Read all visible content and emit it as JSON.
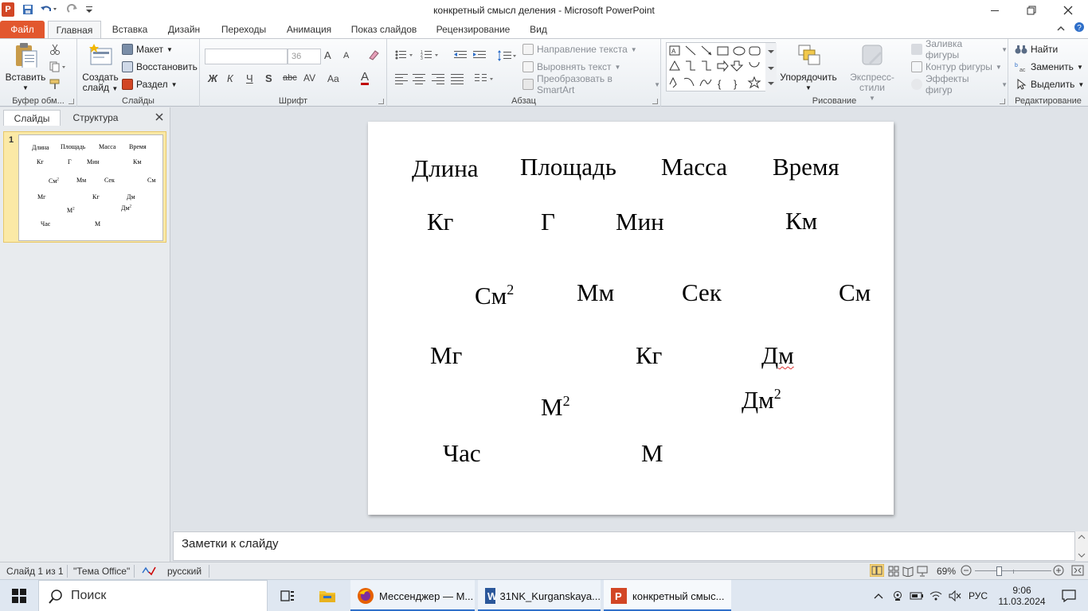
{
  "window": {
    "title": "конкретный смысл деления  -  Microsoft PowerPoint",
    "app_logo": "P"
  },
  "tabs": {
    "file": "Файл",
    "items": [
      "Главная",
      "Вставка",
      "Дизайн",
      "Переходы",
      "Анимация",
      "Показ слайдов",
      "Рецензирование",
      "Вид"
    ]
  },
  "ribbon": {
    "clipboard": {
      "paste": "Вставить",
      "label": "Буфер обм..."
    },
    "slides": {
      "new_slide_line1": "Создать",
      "new_slide_line2": "слайд",
      "layout": "Макет",
      "reset": "Восстановить",
      "section": "Раздел",
      "label": "Слайды"
    },
    "font": {
      "font_name": "",
      "font_size": "36",
      "label": "Шрифт",
      "bold": "Ж",
      "italic": "К",
      "underline": "Ч",
      "shadow": "S",
      "strike": "abc",
      "spacing": "AV",
      "case": "Aa",
      "color": "A",
      "grow": "A",
      "shrink": "A"
    },
    "paragraph": {
      "text_direction": "Направление текста",
      "align_text": "Выровнять текст",
      "smartart": "Преобразовать в SmartArt",
      "label": "Абзац"
    },
    "drawing": {
      "arrange": "Упорядочить",
      "quick_styles": "Экспресс-стили",
      "shape_fill": "Заливка фигуры",
      "shape_outline": "Контур фигуры",
      "shape_effects": "Эффекты фигур",
      "label": "Рисование"
    },
    "editing": {
      "find": "Найти",
      "replace": "Заменить",
      "select": "Выделить",
      "label": "Редактирование"
    }
  },
  "left_panel": {
    "tab_slides": "Слайды",
    "tab_outline": "Структура",
    "slide_number": "1"
  },
  "slide": {
    "row1": [
      "Длина",
      "Площадь",
      "Масса",
      "Время"
    ],
    "kg1": "Кг",
    "g": "Г",
    "min": "Мин",
    "km": "Км",
    "cm2": "См",
    "mm": "Мм",
    "sek": "Сек",
    "sm": "См",
    "mg": "Мг",
    "kg2": "Кг",
    "dm": "Дм",
    "m2": "М",
    "dm2": "Дм",
    "chas": "Час",
    "m": "М",
    "sup2": "2"
  },
  "notes": {
    "placeholder": "Заметки к слайду"
  },
  "status": {
    "slide_info": "Слайд 1 из 1",
    "theme": "\"Тема Office\"",
    "language": "русский",
    "zoom": "69%",
    "zoom_fraction": 0.69
  },
  "taskbar": {
    "search": "Поиск",
    "apps": [
      {
        "label": "Мессенджер — М..."
      },
      {
        "label": "31NK_Kurganskaya..."
      },
      {
        "label": "конкретный смыс..."
      }
    ],
    "lang": "РУС",
    "time": "9:06",
    "date": "11.03.2024"
  },
  "colors": {
    "file_tab": "#e2572e",
    "ppt_brand": "#d24625",
    "thumb_selected": "#fbe9a6",
    "taskbar_accent": "#2f6fc9"
  }
}
